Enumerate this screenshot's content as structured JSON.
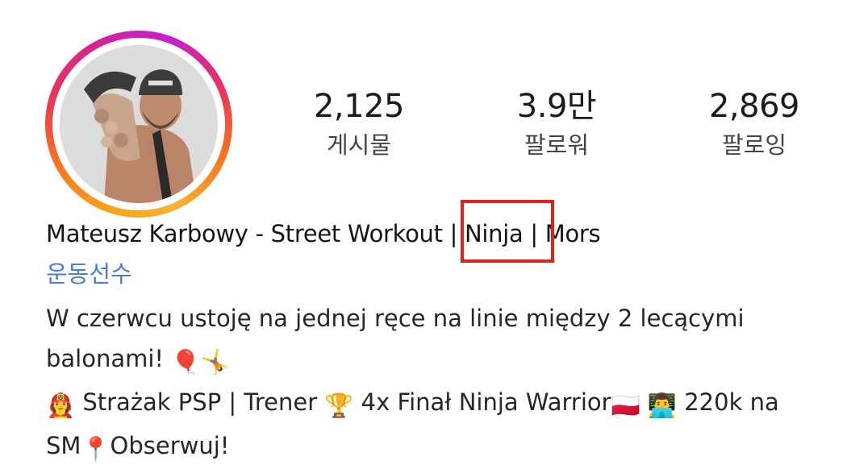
{
  "profile": {
    "name": "Mateusz Karbowy - Street Workout | Ninja | Mors",
    "category": "운동선수",
    "avatar_icon": "profile-photo",
    "story_ring_colors": [
      "#f7a21b",
      "#e8315f",
      "#c61fd0"
    ]
  },
  "stats": {
    "posts": {
      "value": "2,125",
      "label": "게시물"
    },
    "followers": {
      "value": "3.9만",
      "label": "팔로워"
    },
    "following": {
      "value": "2,869",
      "label": "팔로잉"
    }
  },
  "bio": {
    "line1": "W czerwcu ustoję na jednej ręce na linie między 2 lecącymi",
    "line2_text": "balonami!",
    "line3_part1": "Strażak PSP | Trener",
    "line3_part2": "4x Finał Ninja Warrior",
    "line3_part3": "220k na",
    "line4_part1": "SM",
    "line4_part2": "Obserwuj!"
  },
  "emojis": {
    "balloon": "🎈",
    "cartwheel": "🤸",
    "firefighter": "👩‍🚒",
    "trophy": "🏆",
    "poland_flag": "🇵🇱",
    "technologist": "👨‍💻",
    "pin": "📍"
  },
  "highlight_color": "#e0201c"
}
